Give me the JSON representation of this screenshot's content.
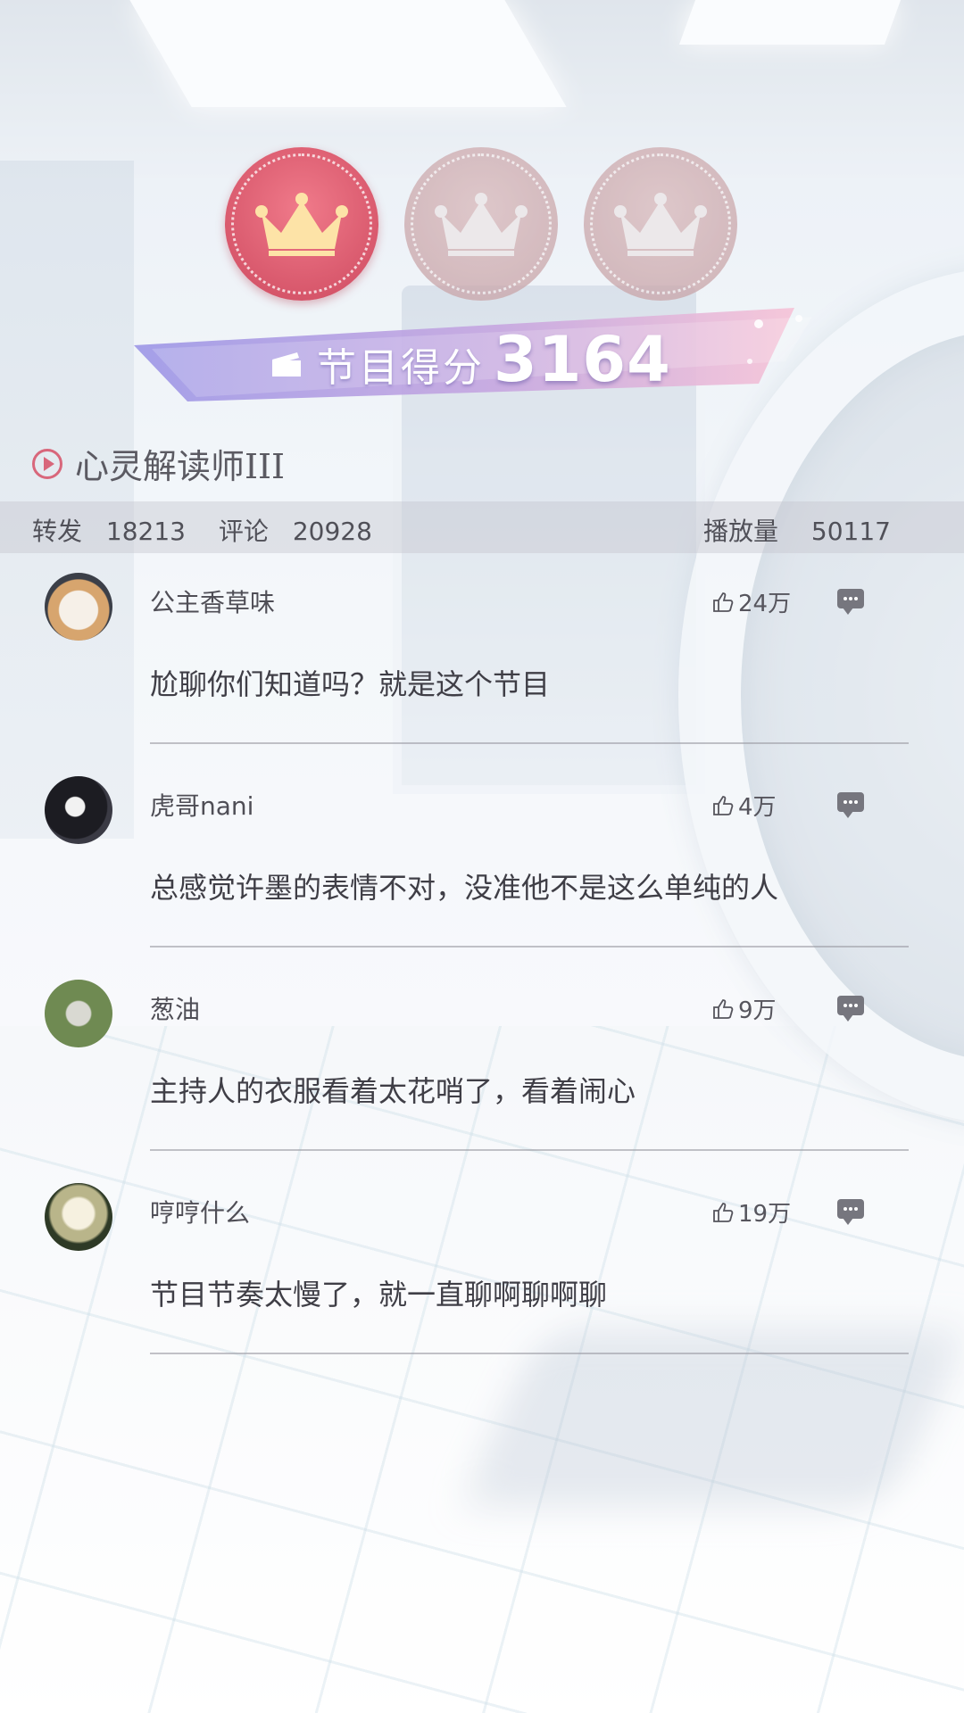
{
  "score_banner": {
    "label": "节目得分",
    "score": "3164"
  },
  "crowns": [
    {
      "state": "active",
      "icon": "crown-icon"
    },
    {
      "state": "inactive",
      "icon": "crown-icon"
    },
    {
      "state": "inactive",
      "icon": "crown-icon"
    }
  ],
  "program": {
    "title": "心灵解读师III",
    "icon": "play-icon"
  },
  "stats": {
    "share_label": "转发",
    "share_count": "18213",
    "comment_label": "评论",
    "comment_count": "20928",
    "play_label": "播放量",
    "play_count": "50117"
  },
  "comments": [
    {
      "user": "公主香草味",
      "likes": "24万",
      "text": "尬聊你们知道吗？就是这个节目",
      "avatar": "dog-avatar"
    },
    {
      "user": "虎哥nani",
      "likes": "4万",
      "text": "总感觉许墨的表情不对，没准他不是这么单纯的人",
      "avatar": "cat-avatar"
    },
    {
      "user": "葱油",
      "likes": "9万",
      "text": "主持人的衣服看着太花哨了，看着闹心",
      "avatar": "statue-avatar"
    },
    {
      "user": "哼哼什么",
      "likes": "19万",
      "text": "节目节奏太慢了，就一直聊啊聊啊聊",
      "avatar": "flower-avatar"
    }
  ],
  "colors": {
    "accent": "#d8677b",
    "banner_left": "#a9a2e8",
    "banner_right": "#f2b8cf"
  }
}
